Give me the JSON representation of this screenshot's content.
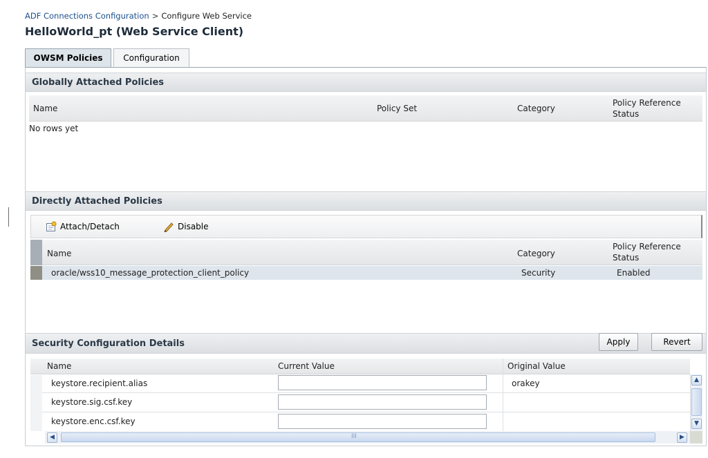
{
  "breadcrumb": {
    "link": "ADF Connections Configuration",
    "separator": ">",
    "current": "Configure Web Service"
  },
  "page_title": "HelloWorld_pt (Web Service Client)",
  "tabs": [
    {
      "label": "OWSM Policies",
      "active": true
    },
    {
      "label": "Configuration",
      "active": false
    }
  ],
  "global_policies": {
    "title": "Globally Attached Policies",
    "columns": [
      "Name",
      "Policy Set",
      "Category",
      "Policy Reference",
      "Status"
    ],
    "empty_text": "No rows yet"
  },
  "direct_policies": {
    "title": "Directly Attached Policies",
    "toolbar": {
      "attach_label": "Attach/Detach",
      "disable_label": "Disable"
    },
    "columns": [
      "Name",
      "Category",
      "Policy Reference",
      "Status"
    ],
    "rows": [
      {
        "name": "oracle/wss10_message_protection_client_policy",
        "category": "Security",
        "status": "Enabled"
      }
    ]
  },
  "security_details": {
    "title": "Security Configuration Details",
    "apply_label": "Apply",
    "revert_label": "Revert",
    "columns": [
      "Name",
      "Current Value",
      "Original Value"
    ],
    "rows": [
      {
        "name": "keystore.recipient.alias",
        "current": "",
        "original": "orakey"
      },
      {
        "name": "keystore.sig.csf.key",
        "current": "",
        "original": ""
      },
      {
        "name": "keystore.enc.csf.key",
        "current": "",
        "original": ""
      }
    ],
    "scroll_thumb_grip": "III"
  },
  "colors": {
    "link": "#1b4f8d",
    "section_header_bg": "#dcdfe2",
    "selected_row": "#dfe5ec",
    "active_tab": "#dde4ea"
  }
}
